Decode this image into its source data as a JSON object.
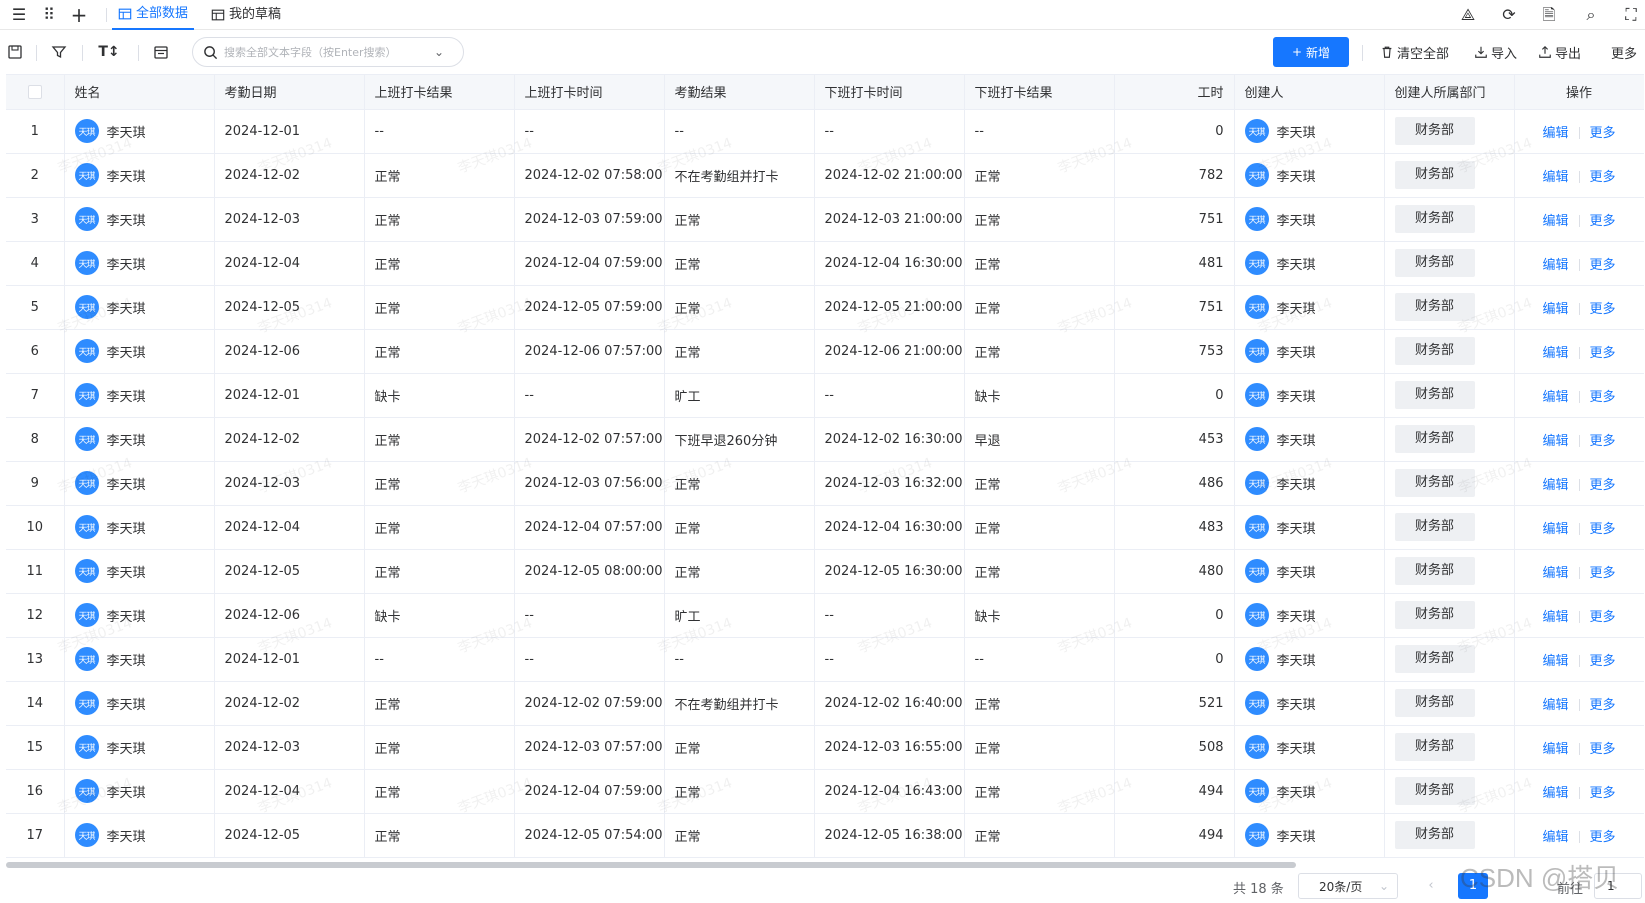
{
  "tabs": [
    {
      "label": "全部数据",
      "active": true
    },
    {
      "label": "我的草稿",
      "active": false
    }
  ],
  "toolbar": {
    "search_placeholder": "搜索全部文本字段（按Enter搜索）",
    "new_label": "新增",
    "clear_label": "清空全部",
    "import_label": "导入",
    "export_label": "导出",
    "more_label": "更多"
  },
  "columns": [
    "",
    "姓名",
    "考勤日期",
    "上班打卡结果",
    "上班打卡时间",
    "考勤结果",
    "下班打卡时间",
    "下班打卡结果",
    "工时",
    "创建人",
    "创建人所属部门",
    "操作"
  ],
  "rows": [
    {
      "idx": "1",
      "name": "李天琪",
      "date": "2024-12-01",
      "in_result": "--",
      "in_time": "--",
      "result": "--",
      "out_time": "--",
      "out_result": "--",
      "hours": "0",
      "creator": "李天琪",
      "dept": "财务部"
    },
    {
      "idx": "2",
      "name": "李天琪",
      "date": "2024-12-02",
      "in_result": "正常",
      "in_time": "2024-12-02 07:58:00",
      "result": "不在考勤组并打卡",
      "out_time": "2024-12-02 21:00:00",
      "out_result": "正常",
      "hours": "782",
      "creator": "李天琪",
      "dept": "财务部"
    },
    {
      "idx": "3",
      "name": "李天琪",
      "date": "2024-12-03",
      "in_result": "正常",
      "in_time": "2024-12-03 07:59:00",
      "result": "正常",
      "out_time": "2024-12-03 21:00:00",
      "out_result": "正常",
      "hours": "751",
      "creator": "李天琪",
      "dept": "财务部"
    },
    {
      "idx": "4",
      "name": "李天琪",
      "date": "2024-12-04",
      "in_result": "正常",
      "in_time": "2024-12-04 07:59:00",
      "result": "正常",
      "out_time": "2024-12-04 16:30:00",
      "out_result": "正常",
      "hours": "481",
      "creator": "李天琪",
      "dept": "财务部"
    },
    {
      "idx": "5",
      "name": "李天琪",
      "date": "2024-12-05",
      "in_result": "正常",
      "in_time": "2024-12-05 07:59:00",
      "result": "正常",
      "out_time": "2024-12-05 21:00:00",
      "out_result": "正常",
      "hours": "751",
      "creator": "李天琪",
      "dept": "财务部"
    },
    {
      "idx": "6",
      "name": "李天琪",
      "date": "2024-12-06",
      "in_result": "正常",
      "in_time": "2024-12-06 07:57:00",
      "result": "正常",
      "out_time": "2024-12-06 21:00:00",
      "out_result": "正常",
      "hours": "753",
      "creator": "李天琪",
      "dept": "财务部"
    },
    {
      "idx": "7",
      "name": "李天琪",
      "date": "2024-12-01",
      "in_result": "缺卡",
      "in_time": "--",
      "result": "旷工",
      "out_time": "--",
      "out_result": "缺卡",
      "hours": "0",
      "creator": "李天琪",
      "dept": "财务部"
    },
    {
      "idx": "8",
      "name": "李天琪",
      "date": "2024-12-02",
      "in_result": "正常",
      "in_time": "2024-12-02 07:57:00",
      "result": "下班早退260分钟",
      "out_time": "2024-12-02 16:30:00",
      "out_result": "早退",
      "hours": "453",
      "creator": "李天琪",
      "dept": "财务部"
    },
    {
      "idx": "9",
      "name": "李天琪",
      "date": "2024-12-03",
      "in_result": "正常",
      "in_time": "2024-12-03 07:56:00",
      "result": "正常",
      "out_time": "2024-12-03 16:32:00",
      "out_result": "正常",
      "hours": "486",
      "creator": "李天琪",
      "dept": "财务部"
    },
    {
      "idx": "10",
      "name": "李天琪",
      "date": "2024-12-04",
      "in_result": "正常",
      "in_time": "2024-12-04 07:57:00",
      "result": "正常",
      "out_time": "2024-12-04 16:30:00",
      "out_result": "正常",
      "hours": "483",
      "creator": "李天琪",
      "dept": "财务部"
    },
    {
      "idx": "11",
      "name": "李天琪",
      "date": "2024-12-05",
      "in_result": "正常",
      "in_time": "2024-12-05 08:00:00",
      "result": "正常",
      "out_time": "2024-12-05 16:30:00",
      "out_result": "正常",
      "hours": "480",
      "creator": "李天琪",
      "dept": "财务部"
    },
    {
      "idx": "12",
      "name": "李天琪",
      "date": "2024-12-06",
      "in_result": "缺卡",
      "in_time": "--",
      "result": "旷工",
      "out_time": "--",
      "out_result": "缺卡",
      "hours": "0",
      "creator": "李天琪",
      "dept": "财务部"
    },
    {
      "idx": "13",
      "name": "李天琪",
      "date": "2024-12-01",
      "in_result": "--",
      "in_time": "--",
      "result": "--",
      "out_time": "--",
      "out_result": "--",
      "hours": "0",
      "creator": "李天琪",
      "dept": "财务部"
    },
    {
      "idx": "14",
      "name": "李天琪",
      "date": "2024-12-02",
      "in_result": "正常",
      "in_time": "2024-12-02 07:59:00",
      "result": "不在考勤组并打卡",
      "out_time": "2024-12-02 16:40:00",
      "out_result": "正常",
      "hours": "521",
      "creator": "李天琪",
      "dept": "财务部"
    },
    {
      "idx": "15",
      "name": "李天琪",
      "date": "2024-12-03",
      "in_result": "正常",
      "in_time": "2024-12-03 07:57:00",
      "result": "正常",
      "out_time": "2024-12-03 16:55:00",
      "out_result": "正常",
      "hours": "508",
      "creator": "李天琪",
      "dept": "财务部"
    },
    {
      "idx": "16",
      "name": "李天琪",
      "date": "2024-12-04",
      "in_result": "正常",
      "in_time": "2024-12-04 07:59:00",
      "result": "正常",
      "out_time": "2024-12-04 16:43:00",
      "out_result": "正常",
      "hours": "494",
      "creator": "李天琪",
      "dept": "财务部"
    },
    {
      "idx": "17",
      "name": "李天琪",
      "date": "2024-12-05",
      "in_result": "正常",
      "in_time": "2024-12-05 07:54:00",
      "result": "正常",
      "out_time": "2024-12-05 16:38:00",
      "out_result": "正常",
      "hours": "494",
      "creator": "李天琪",
      "dept": "财务部"
    }
  ],
  "avatar_text": "天琪",
  "row_actions": {
    "edit": "编辑",
    "more": "更多"
  },
  "watermark": "李天琪0314",
  "pagination": {
    "total": "共 18 条",
    "page_size": "20条/页",
    "current_page": "1",
    "goto_label": "前往",
    "goto_value": "1"
  },
  "credit": "CSDN @搭贝",
  "colors": {
    "accent": "#1677ff",
    "avatar": "#2f8cff",
    "header_bg": "#f5f7fa"
  }
}
